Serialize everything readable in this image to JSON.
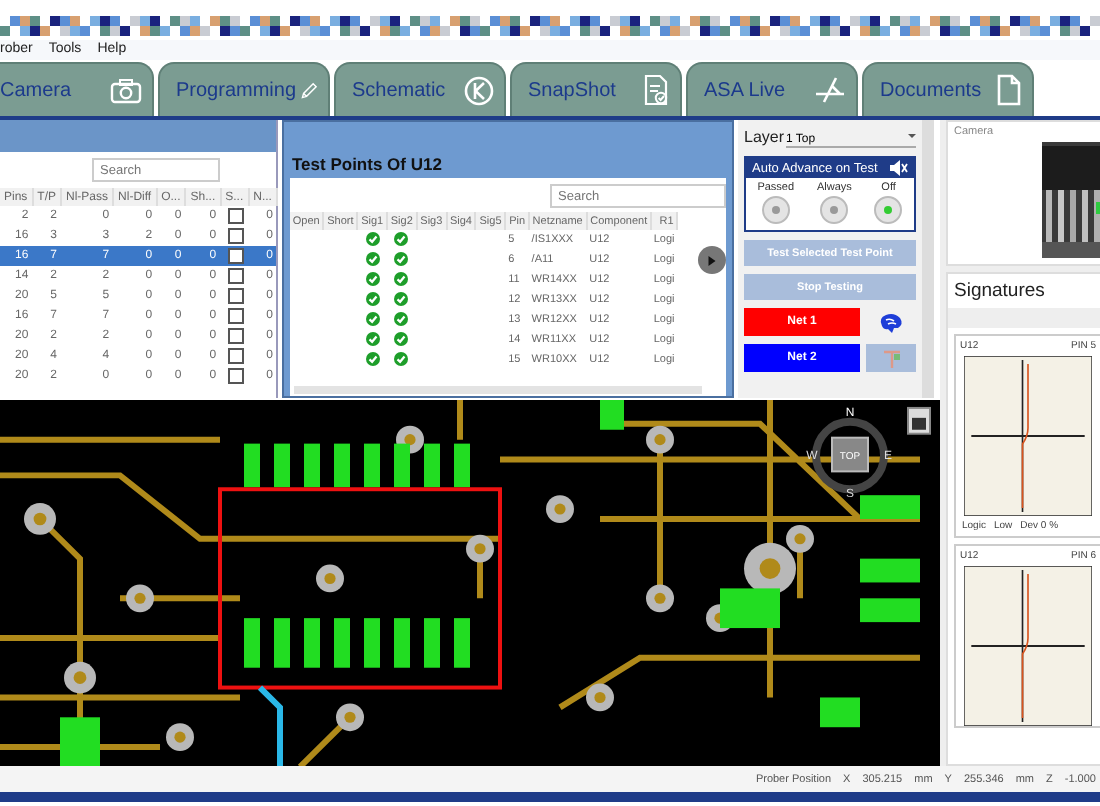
{
  "menu": [
    "rober",
    "Tools",
    "Help"
  ],
  "tabs": [
    {
      "label": "Camera",
      "selected": false
    },
    {
      "label": "Programming",
      "selected": false
    },
    {
      "label": "Schematic",
      "selected": false
    },
    {
      "label": "SnapShot",
      "selected": false
    },
    {
      "label": "ASA Live",
      "selected": false
    },
    {
      "label": "Documents",
      "selected": false
    }
  ],
  "component_table": {
    "search": {
      "placeholder": "Search"
    },
    "columns": [
      "Pins",
      "T/P",
      "Nl-Pass",
      "Nl-Diff",
      "O...",
      "Sh...",
      "S...",
      "N..."
    ],
    "rows": [
      {
        "cells": [
          "2",
          "2",
          "0",
          "0",
          "0",
          "0"
        ],
        "checked": false,
        "last": "0",
        "selected": false
      },
      {
        "cells": [
          "16",
          "3",
          "3",
          "2",
          "0",
          "0"
        ],
        "checked": false,
        "last": "0",
        "selected": false
      },
      {
        "cells": [
          "16",
          "7",
          "7",
          "0",
          "0",
          "0"
        ],
        "checked": false,
        "last": "0",
        "selected": true
      },
      {
        "cells": [
          "14",
          "2",
          "2",
          "0",
          "0",
          "0"
        ],
        "checked": false,
        "last": "0",
        "selected": false
      },
      {
        "cells": [
          "20",
          "5",
          "5",
          "0",
          "0",
          "0"
        ],
        "checked": false,
        "last": "0",
        "selected": false
      },
      {
        "cells": [
          "16",
          "7",
          "7",
          "0",
          "0",
          "0"
        ],
        "checked": false,
        "last": "0",
        "selected": false
      },
      {
        "cells": [
          "20",
          "2",
          "2",
          "0",
          "0",
          "0"
        ],
        "checked": false,
        "last": "0",
        "selected": false
      },
      {
        "cells": [
          "20",
          "4",
          "4",
          "0",
          "0",
          "0"
        ],
        "checked": false,
        "last": "0",
        "selected": false
      },
      {
        "cells": [
          "20",
          "2",
          "0",
          "0",
          "0",
          "0"
        ],
        "checked": false,
        "last": "0",
        "selected": false
      }
    ]
  },
  "test_points": {
    "title": "Test Points Of U12",
    "search": {
      "placeholder": "Search"
    },
    "columns": [
      "Open",
      "Short",
      "Sig1",
      "Sig2",
      "Sig3",
      "Sig4",
      "Sig5",
      "Pin",
      "Netzname",
      "Component",
      "R1"
    ],
    "rows": [
      {
        "sig1": true,
        "sig2": true,
        "pin": "5",
        "netzname": "/IS1XXX",
        "component": "U12",
        "r1": "Logi"
      },
      {
        "sig1": true,
        "sig2": true,
        "pin": "6",
        "netzname": "/A11",
        "component": "U12",
        "r1": "Logi"
      },
      {
        "sig1": true,
        "sig2": true,
        "pin": "11",
        "netzname": "WR14XX",
        "component": "U12",
        "r1": "Logi"
      },
      {
        "sig1": true,
        "sig2": true,
        "pin": "12",
        "netzname": "WR13XX",
        "component": "U12",
        "r1": "Logi"
      },
      {
        "sig1": true,
        "sig2": true,
        "pin": "13",
        "netzname": "WR12XX",
        "component": "U12",
        "r1": "Logi"
      },
      {
        "sig1": true,
        "sig2": true,
        "pin": "14",
        "netzname": "WR11XX",
        "component": "U12",
        "r1": "Logi"
      },
      {
        "sig1": true,
        "sig2": true,
        "pin": "15",
        "netzname": "WR10XX",
        "component": "U12",
        "r1": "Logi"
      }
    ]
  },
  "controls": {
    "layer_label": "Layer",
    "layer_value": "1 Top",
    "auto_advance": {
      "title": "Auto Advance on Test",
      "options": [
        {
          "label": "Passed",
          "selected": false
        },
        {
          "label": "Always",
          "selected": false
        },
        {
          "label": "Off",
          "selected": true
        }
      ]
    },
    "buttons": [
      {
        "label": "Test Selected Test Point",
        "disabled": true
      },
      {
        "label": "Stop Testing",
        "disabled": true
      }
    ],
    "nets": [
      {
        "label": "Net 1",
        "color": "#ff0000"
      },
      {
        "label": "Net 2",
        "color": "#0000ff"
      }
    ]
  },
  "pcb": {
    "compass": [
      "N",
      "E",
      "S",
      "W"
    ],
    "view_button": "TOP"
  },
  "camera": {
    "label": "Camera"
  },
  "signatures": {
    "title": "Signatures",
    "cards": [
      {
        "component": "U12",
        "pin": "PIN 5",
        "footer": [
          "Logic",
          "Low",
          "Dev 0 %"
        ]
      },
      {
        "component": "U12",
        "pin": "PIN 6"
      }
    ]
  },
  "status_bar": {
    "label": "Prober Position",
    "fields": [
      {
        "axis": "X",
        "value": "305.215",
        "unit": "mm"
      },
      {
        "axis": "Y",
        "value": "255.346",
        "unit": "mm"
      },
      {
        "axis": "Z",
        "value": "-1.000"
      }
    ]
  }
}
